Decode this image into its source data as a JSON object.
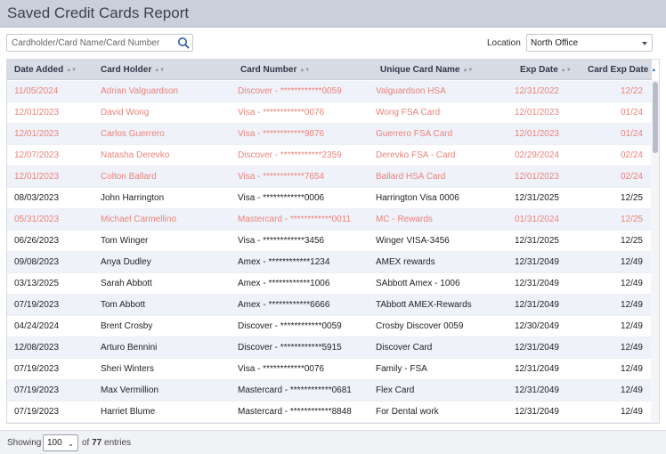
{
  "header": {
    "title": "Saved Credit Cards Report"
  },
  "search": {
    "placeholder": "Cardholder/Card Name/Card Number"
  },
  "location": {
    "label": "Location",
    "value": "North Office"
  },
  "table": {
    "columns": [
      {
        "key": "date_added",
        "label": "Date Added"
      },
      {
        "key": "card_holder",
        "label": "Card Holder"
      },
      {
        "key": "card_number",
        "label": "Card Number"
      },
      {
        "key": "unique_name",
        "label": "Unique Card Name"
      },
      {
        "key": "exp_date",
        "label": "Exp Date"
      },
      {
        "key": "card_exp_date",
        "label": "Card Exp Date",
        "sorted": "asc"
      }
    ],
    "rows": [
      {
        "date_added": "11/05/2024",
        "card_holder": "Adrian Valguardson",
        "card_number": "Discover - ************0059",
        "unique_name": "Valguardson HSA",
        "exp_date": "12/31/2022",
        "card_exp_date": "12/22",
        "expired": true
      },
      {
        "date_added": "12/01/2023",
        "card_holder": "David Wong",
        "card_number": "Visa - ************0076",
        "unique_name": "Wong FSA Card",
        "exp_date": "12/01/2023",
        "card_exp_date": "01/24",
        "expired": true
      },
      {
        "date_added": "12/01/2023",
        "card_holder": "Carlos Guerrero",
        "card_number": "Visa - ************9876",
        "unique_name": "Guerrero FSA Card",
        "exp_date": "12/01/2023",
        "card_exp_date": "01/24",
        "expired": true
      },
      {
        "date_added": "12/07/2023",
        "card_holder": "Natasha Derevko",
        "card_number": "Discover - ************2359",
        "unique_name": "Derevko FSA - Card",
        "exp_date": "02/29/2024",
        "card_exp_date": "02/24",
        "expired": true
      },
      {
        "date_added": "12/01/2023",
        "card_holder": "Colton Ballard",
        "card_number": "Visa - ************7654",
        "unique_name": "Ballard HSA Card",
        "exp_date": "12/01/2023",
        "card_exp_date": "02/24",
        "expired": true
      },
      {
        "date_added": "08/03/2023",
        "card_holder": "John Harrington",
        "card_number": "Visa - ************0006",
        "unique_name": "Harrington Visa 0006",
        "exp_date": "12/31/2025",
        "card_exp_date": "12/25",
        "expired": false
      },
      {
        "date_added": "05/31/2023",
        "card_holder": "Michael Carmellino",
        "card_number": "Mastercard - ************0011",
        "unique_name": "MC - Rewards",
        "exp_date": "01/31/2024",
        "card_exp_date": "12/25",
        "expired": true
      },
      {
        "date_added": "06/26/2023",
        "card_holder": "Tom Winger",
        "card_number": "Visa - ************3456",
        "unique_name": "Winger VISA-3456",
        "exp_date": "12/31/2025",
        "card_exp_date": "12/25",
        "expired": false
      },
      {
        "date_added": "09/08/2023",
        "card_holder": "Anya Dudley",
        "card_number": "Amex - ************1234",
        "unique_name": "AMEX rewards",
        "exp_date": "12/31/2049",
        "card_exp_date": "12/49",
        "expired": false
      },
      {
        "date_added": "03/13/2025",
        "card_holder": "Sarah Abbott",
        "card_number": "Amex - ************1006",
        "unique_name": "SAbbott Amex - 1006",
        "exp_date": "12/31/2049",
        "card_exp_date": "12/49",
        "expired": false
      },
      {
        "date_added": "07/19/2023",
        "card_holder": "Tom Abbott",
        "card_number": "Amex - ************6666",
        "unique_name": "TAbbott AMEX-Rewards",
        "exp_date": "12/31/2049",
        "card_exp_date": "12/49",
        "expired": false
      },
      {
        "date_added": "04/24/2024",
        "card_holder": "Brent Crosby",
        "card_number": "Discover - ************0059",
        "unique_name": "Crosby Discover 0059",
        "exp_date": "12/30/2049",
        "card_exp_date": "12/49",
        "expired": false
      },
      {
        "date_added": "12/08/2023",
        "card_holder": "Arturo Bennini",
        "card_number": "Discover - ************5915",
        "unique_name": "Discover Card",
        "exp_date": "12/31/2049",
        "card_exp_date": "12/49",
        "expired": false
      },
      {
        "date_added": "07/19/2023",
        "card_holder": "Sheri Winters",
        "card_number": "Visa - ************0076",
        "unique_name": "Family - FSA",
        "exp_date": "12/31/2049",
        "card_exp_date": "12/49",
        "expired": false
      },
      {
        "date_added": "07/19/2023",
        "card_holder": "Max Vermillion",
        "card_number": "Mastercard - ************0681",
        "unique_name": "Flex Card",
        "exp_date": "12/31/2049",
        "card_exp_date": "12/49",
        "expired": false
      },
      {
        "date_added": "07/19/2023",
        "card_holder": "Harriet Blume",
        "card_number": "Mastercard - ************8848",
        "unique_name": "For Dental work",
        "exp_date": "12/31/2049",
        "card_exp_date": "12/49",
        "expired": false
      }
    ]
  },
  "footer": {
    "showing_label": "Showing",
    "page_size": "100",
    "of_label": "of",
    "total": "77",
    "entries_label": "entries"
  },
  "colors": {
    "expired_text": "#e8837a",
    "header_bg": "#c9cfdb",
    "alt_row_bg": "#f0f2fa",
    "sort_active": "#2d6fc4"
  }
}
